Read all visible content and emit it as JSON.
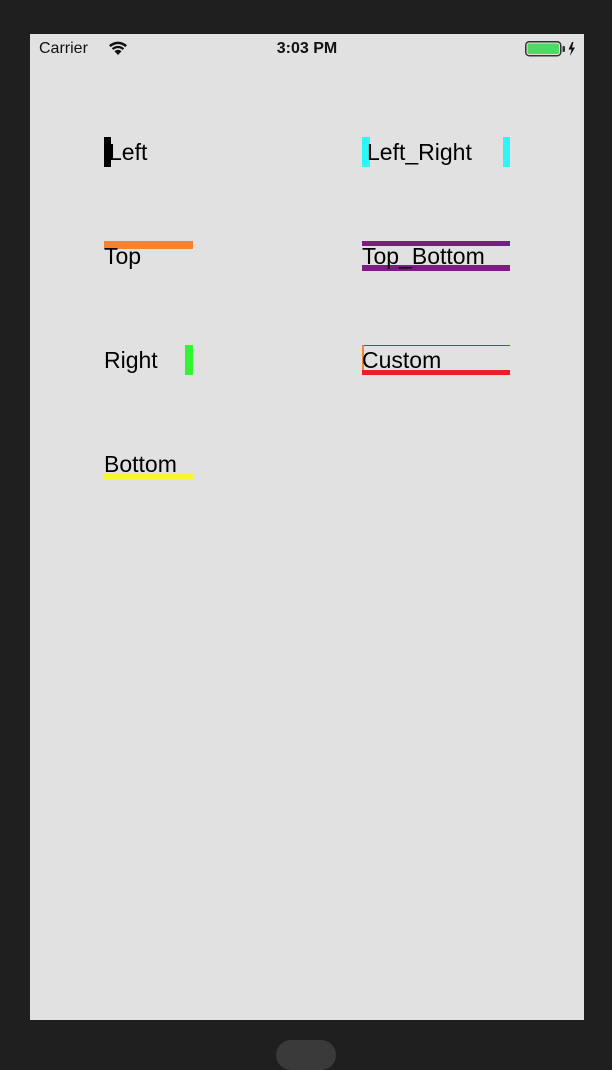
{
  "status_bar": {
    "carrier": "Carrier",
    "time": "3:03 PM",
    "icons": [
      "wifi-icon",
      "battery-charging-icon"
    ],
    "battery_color": "#4cd964"
  },
  "labels": {
    "left": {
      "text": "Left",
      "border_color": "#000000"
    },
    "left_right": {
      "text": "Left_Right",
      "border_color": "#2ff6f6"
    },
    "top": {
      "text": "Top",
      "border_color": "#f58231"
    },
    "top_bottom": {
      "text": "Top_Bottom",
      "border_color": "#7d1a84"
    },
    "right": {
      "text": "Right",
      "border_color": "#2ff62f"
    },
    "custom": {
      "text": "Custom",
      "border_top_color": "#3b4bf0",
      "border_left_color": "#f58231",
      "border_bottom_color": "#ee1c24"
    },
    "bottom": {
      "text": "Bottom",
      "border_color": "#f6f62f"
    }
  },
  "colors": {
    "screen_background": "#e1e1e1",
    "device_bezel": "#1f1f1f"
  }
}
